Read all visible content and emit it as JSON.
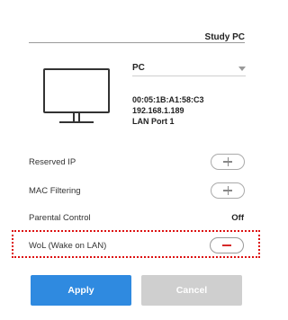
{
  "device": {
    "name": "Study PC",
    "type_selected": "PC",
    "mac": "00:05:1B:A1:58:C3",
    "ip": "192.168.1.189",
    "port": "LAN Port 1"
  },
  "options": {
    "reserved_ip": "Reserved IP",
    "mac_filtering": "MAC Filtering",
    "parental_control": "Parental Control",
    "parental_control_value": "Off",
    "wol": "WoL (Wake on LAN)"
  },
  "buttons": {
    "apply": "Apply",
    "cancel": "Cancel"
  },
  "colors": {
    "apply": "#2f8ae0",
    "cancel_disabled": "#cfcfcf",
    "highlight": "#dd1111",
    "minus": "#d62828"
  }
}
